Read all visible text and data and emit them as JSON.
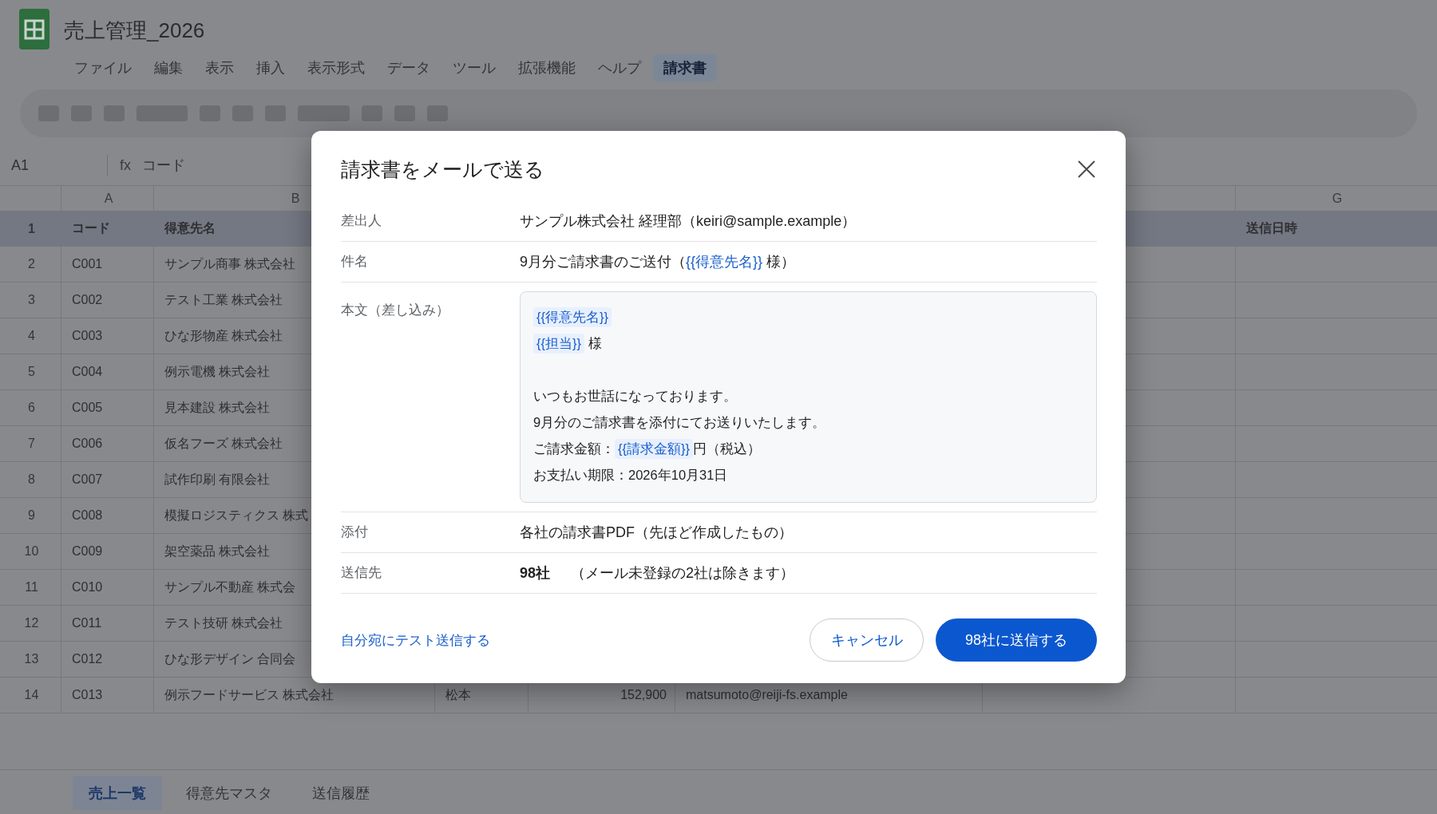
{
  "app": {
    "title": "売上管理_2026"
  },
  "menu": [
    {
      "label": "ファイル",
      "selected": false
    },
    {
      "label": "編集",
      "selected": false
    },
    {
      "label": "表示",
      "selected": false
    },
    {
      "label": "挿入",
      "selected": false
    },
    {
      "label": "表示形式",
      "selected": false
    },
    {
      "label": "データ",
      "selected": false
    },
    {
      "label": "ツール",
      "selected": false
    },
    {
      "label": "拡張機能",
      "selected": false
    },
    {
      "label": "ヘルプ",
      "selected": false
    },
    {
      "label": "請求書",
      "selected": true
    }
  ],
  "formula_bar": {
    "cell_reference": "A1",
    "function_label": "fx",
    "content": "コード"
  },
  "sheet": {
    "column_letters": {
      "column_1": "A",
      "column_2": "B",
      "column_7": "G"
    },
    "header_row": {
      "row_number": "1",
      "column_1": "コード",
      "column_2": "得意先名",
      "column_7": "送信日時"
    },
    "rows": [
      {
        "row_number": "2",
        "column_1": "C001",
        "column_2": "サンプル商事 株式会社"
      },
      {
        "row_number": "3",
        "column_1": "C002",
        "column_2": "テスト工業 株式会社"
      },
      {
        "row_number": "4",
        "column_1": "C003",
        "column_2": "ひな形物産 株式会社"
      },
      {
        "row_number": "5",
        "column_1": "C004",
        "column_2": "例示電機 株式会社"
      },
      {
        "row_number": "6",
        "column_1": "C005",
        "column_2": "見本建設 株式会社"
      },
      {
        "row_number": "7",
        "column_1": "C006",
        "column_2": "仮名フーズ 株式会社"
      },
      {
        "row_number": "8",
        "column_1": "C007",
        "column_2": "試作印刷 有限会社"
      },
      {
        "row_number": "9",
        "column_1": "C008",
        "column_2": "模擬ロジスティクス 株式"
      },
      {
        "row_number": "10",
        "column_1": "C009",
        "column_2": "架空薬品 株式会社"
      },
      {
        "row_number": "11",
        "column_1": "C010",
        "column_2": "サンプル不動産 株式会"
      },
      {
        "row_number": "12",
        "column_1": "C011",
        "column_2": "テスト技研 株式会社"
      },
      {
        "row_number": "13",
        "column_1": "C012",
        "column_2": "ひな形デザイン 合同会"
      },
      {
        "row_number": "14",
        "column_1": "C013",
        "column_2": "例示フードサービス 株式会社",
        "column_3": "松本",
        "column_4": "152,900",
        "column_5": "matsumoto@reiji-fs.example"
      }
    ]
  },
  "dialog": {
    "title": "請求書をメールで送る",
    "fields": [
      {
        "kind": "text",
        "label": "差出人",
        "parts": [
          {
            "kind": "text",
            "text": "サンプル株式会社 経理部（keiri@sample.example）"
          }
        ]
      },
      {
        "kind": "text",
        "label": "件名",
        "parts": [
          {
            "kind": "text",
            "text": "9月分ご請求書のご送付（"
          },
          {
            "kind": "merge_field",
            "text": "{{得意先名}}"
          },
          {
            "kind": "text",
            "text": " 様）"
          }
        ]
      },
      {
        "kind": "body",
        "label": "本文（差し込み）",
        "paragraphs": [
          [
            [
              {
                "kind": "merge_field",
                "text": "{{得意先名}}"
              }
            ],
            [
              {
                "kind": "merge_field",
                "text": "{{担当}}"
              },
              {
                "kind": "text",
                "text": " 様"
              }
            ]
          ],
          [
            [
              {
                "kind": "text",
                "text": "いつもお世話になっております。"
              }
            ],
            [
              {
                "kind": "text",
                "text": "9月分のご請求書を添付にてお送りいたします。"
              }
            ],
            [
              {
                "kind": "text",
                "text": "ご請求金額："
              },
              {
                "kind": "merge_field",
                "text": "{{請求金額}}"
              },
              {
                "kind": "text",
                "text": "円（税込）"
              }
            ],
            [
              {
                "kind": "text",
                "text": "お支払い期限：2026年10月31日"
              }
            ]
          ]
        ]
      },
      {
        "kind": "text",
        "label": "添付",
        "parts": [
          {
            "kind": "text",
            "text": "各社の請求書PDF（先ほど作成したもの）"
          }
        ]
      },
      {
        "kind": "recipients",
        "label": "送信先",
        "count": "98社",
        "note": "（メール未登録の2社は除きます）"
      }
    ],
    "test_send_link": "自分宛にテスト送信する",
    "cancel_button": "キャンセル",
    "send_button": "98社に送信する"
  },
  "sheet_tabs": [
    {
      "label": "売上一覧",
      "selected": true
    },
    {
      "label": "得意先マスタ",
      "selected": false
    },
    {
      "label": "送信履歴",
      "selected": false
    }
  ]
}
